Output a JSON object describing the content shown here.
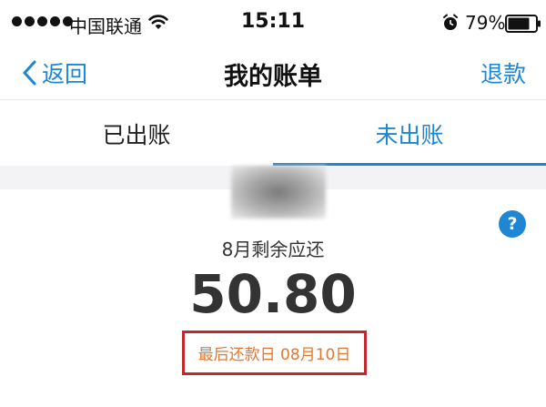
{
  "status_bar": {
    "carrier": "中国联通",
    "time": "15:11",
    "battery": "79%",
    "battery_level": 0.79,
    "icons": [
      "signal-dots",
      "wifi-icon",
      "alarm-icon",
      "battery-icon"
    ]
  },
  "nav": {
    "back_label": "返回",
    "title": "我的账单",
    "refund_label": "退款",
    "accent_color": "#1e86d2"
  },
  "tabs": [
    {
      "label": "已出账",
      "active": false
    },
    {
      "label": "未出账",
      "active": true
    }
  ],
  "bill": {
    "remaining_label": "8月剩余应还",
    "amount": "50.80",
    "due_date": "最后还款日 08月10日",
    "help_glyph": "?",
    "highlight_color": "#c1272d",
    "due_color": "#e07830"
  }
}
